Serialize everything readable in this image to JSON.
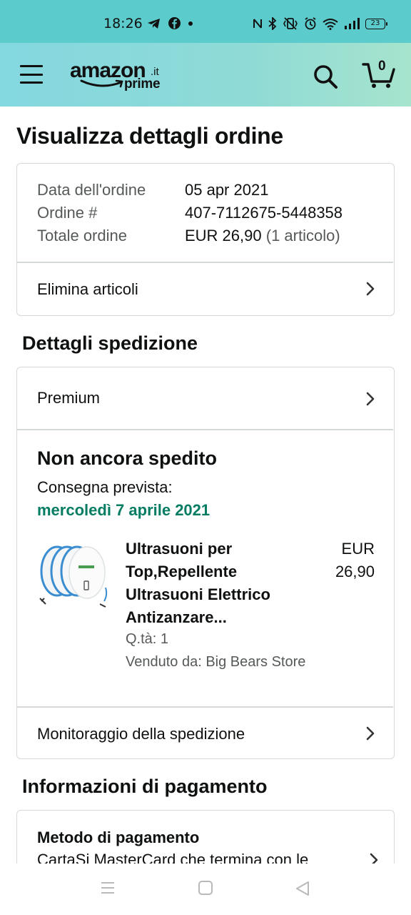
{
  "status_bar": {
    "time": "18:26",
    "battery": "23"
  },
  "header": {
    "logo_main": "amazon",
    "logo_tld": ".it",
    "logo_prime": "prime",
    "cart_count": "0"
  },
  "page": {
    "title": "Visualizza dettagli ordine"
  },
  "order_summary": {
    "rows": [
      {
        "label": "Data dell'ordine",
        "value": "05 apr 2021"
      },
      {
        "label": "Ordine #",
        "value": "407-7112675-5448358"
      },
      {
        "label": "Totale ordine",
        "value": "EUR 26,90",
        "extra": "(1 articolo)"
      }
    ],
    "delete_items_label": "Elimina articoli"
  },
  "shipping": {
    "section_title": "Dettagli spedizione",
    "method_label": "Premium",
    "status_title": "Non ancora spedito",
    "delivery_label": "Consegna prevista:",
    "delivery_date": "mercoledì 7 aprile 2021",
    "product": {
      "title_lines": [
        "Ultrasuoni per",
        "Top,Repellente",
        "Ultrasuoni Elettrico",
        "Antizanzare..."
      ],
      "price_currency": "EUR",
      "price_amount": "26,90",
      "quantity": "Q.tà: 1",
      "seller": "Venduto da: Big Bears Store"
    },
    "tracking_label": "Monitoraggio della spedizione"
  },
  "payment": {
    "section_title": "Informazioni di pagamento",
    "method_title": "Metodo di pagamento",
    "method_desc": "CartaSi MasterCard che termina con le"
  },
  "colors": {
    "status_bar": "#5ccbcb",
    "header_start": "#84d8e0",
    "header_end": "#a6e4cd",
    "delivery_green": "#067d62",
    "border": "#d5d9d9",
    "muted_text": "#565959"
  },
  "icons": {
    "menu": "hamburger-icon",
    "search": "search-icon",
    "cart": "cart-icon",
    "chevron": "chevron-right-icon"
  }
}
